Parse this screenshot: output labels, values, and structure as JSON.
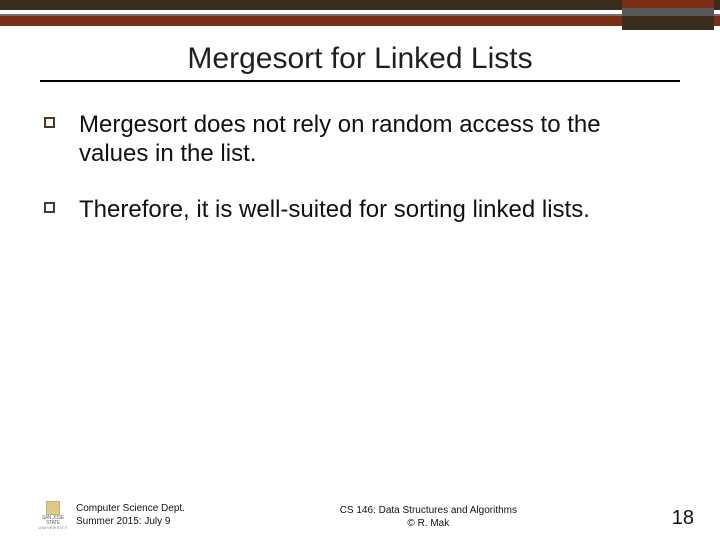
{
  "title": "Mergesort for Linked Lists",
  "bullets": [
    "Mergesort does not rely on random access to the values in the list.",
    "Therefore, it is well-suited for sorting linked lists."
  ],
  "footer": {
    "left_line1": "Computer Science Dept.",
    "left_line2": "Summer 2015: July 9",
    "center_line1": "CS 146: Data Structures and Algorithms",
    "center_line2": "© R. Mak",
    "page": "18",
    "logo_line1": "SAN JOSÉ STATE",
    "logo_line2": "UNIVERSITY"
  }
}
